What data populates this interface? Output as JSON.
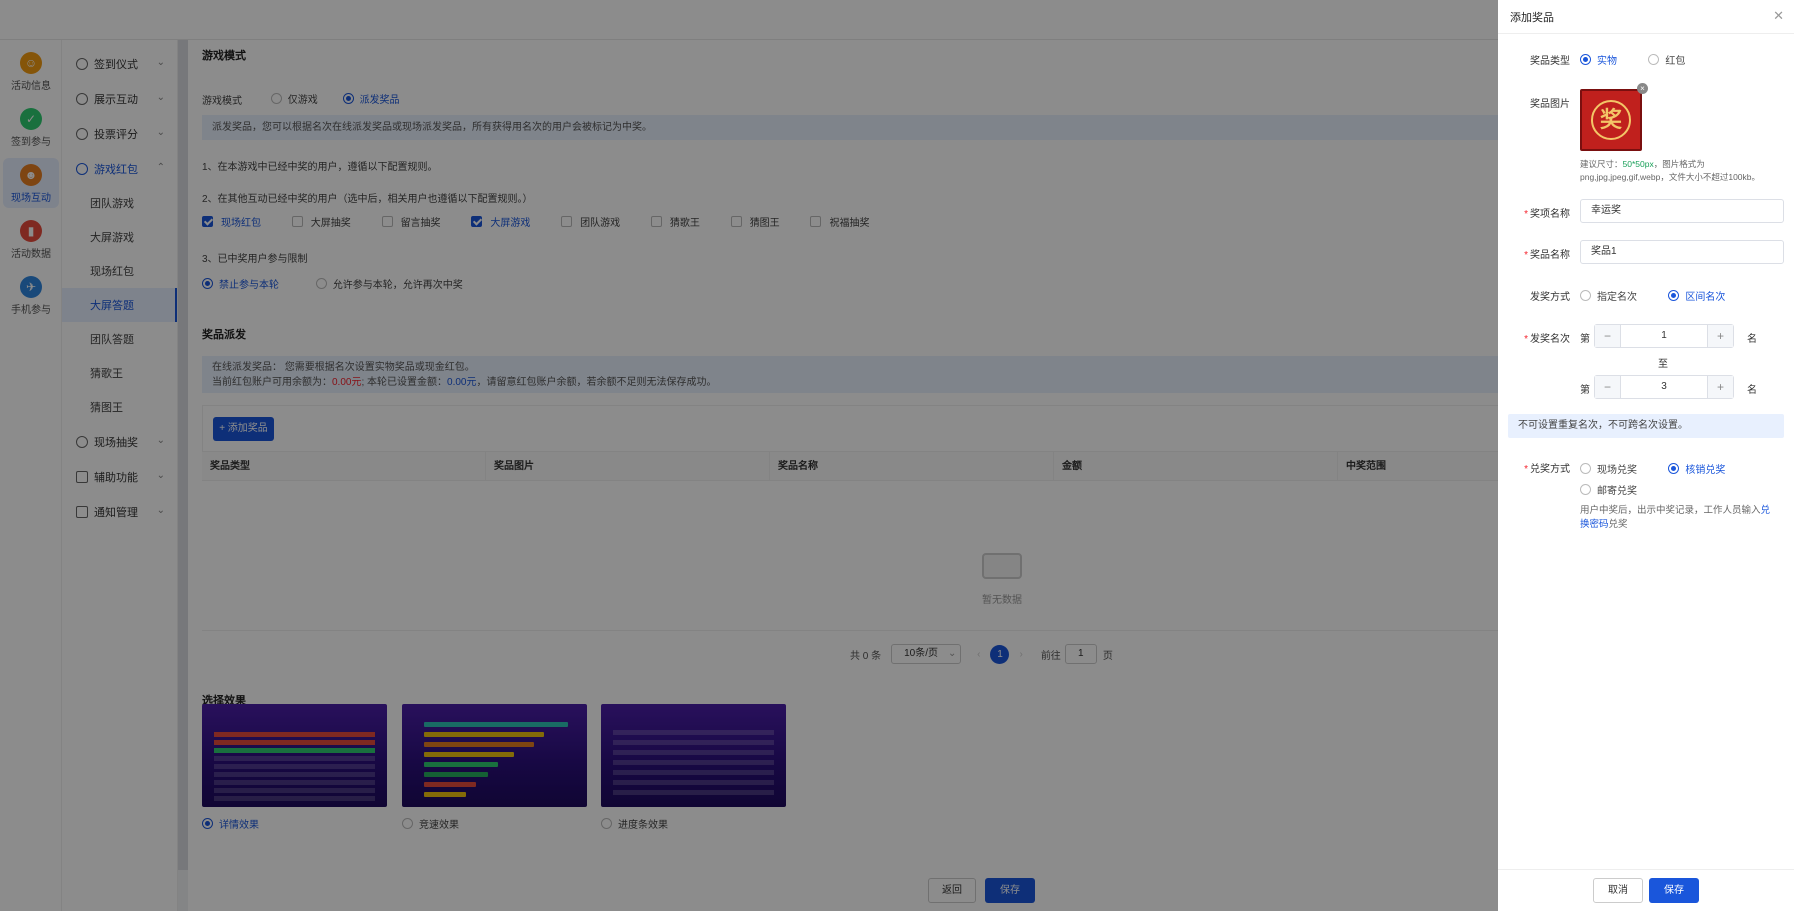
{
  "rail": [
    {
      "label": "活动信息",
      "icon": "activity-info-icon",
      "color": "#f39c12",
      "glyph": "☺"
    },
    {
      "label": "签到参与",
      "icon": "checkin-icon",
      "color": "#2ecc71",
      "glyph": "✓"
    },
    {
      "label": "现场互动",
      "icon": "interaction-icon",
      "color": "#e67e22",
      "glyph": "☻"
    },
    {
      "label": "活动数据",
      "icon": "data-icon",
      "color": "#e74c3c",
      "glyph": "▮"
    },
    {
      "label": "手机参与",
      "icon": "mobile-icon",
      "color": "#2e86de",
      "glyph": "✈"
    }
  ],
  "menu": {
    "groups": [
      {
        "label": "签到仪式"
      },
      {
        "label": "展示互动"
      },
      {
        "label": "投票评分"
      },
      {
        "label": "游戏红包"
      }
    ],
    "subs": [
      "团队游戏",
      "大屏游戏",
      "现场红包",
      "大屏答题",
      "团队答题",
      "猜歌王",
      "猜图王"
    ],
    "groups_after": [
      {
        "label": "现场抽奖"
      },
      {
        "label": "辅助功能"
      },
      {
        "label": "通知管理"
      }
    ]
  },
  "game_mode": {
    "section_title": "游戏模式",
    "label": "游戏模式",
    "options": [
      "仅游戏",
      "派发奖品"
    ],
    "info": "派发奖品，您可以根据名次在线派发奖品或现场派发奖品，所有获得用名次的用户会被标记为中奖。",
    "rule1": "1、在本游戏中已经中奖的用户，遵循以下配置规则。",
    "rule2": "2、在其他互动已经中奖的用户（选中后，相关用户也遵循以下配置规则。）",
    "checks": [
      "现场红包",
      "大屏抽奖",
      "留言抽奖",
      "大屏游戏",
      "团队游戏",
      "猜歌王",
      "猜图王",
      "祝福抽奖"
    ],
    "rule3": "3、已中奖用户参与限制",
    "limits": [
      "禁止参与本轮",
      "允许参与本轮，允许再次中奖"
    ]
  },
  "prize": {
    "section_title": "奖品派发",
    "info_line1": "在线派发奖品：  您需要根据名次设置实物奖品或现金红包。",
    "info_prefix": "当前红包账户可用余额为：",
    "balance": "0.00元",
    "info_mid": "; 本轮已设置金额：",
    "set_amount": "0.00元",
    "info_suffix": "，请留意红包账户余额，若余额不足则无法保存成功。",
    "add_button": "+ 添加奖品",
    "columns": [
      "奖品类型",
      "奖品图片",
      "奖品名称",
      "金额",
      "中奖范围"
    ],
    "empty_text": "暂无数据",
    "pagination": {
      "total": "共 0 条",
      "page_size": "10条/页",
      "current": "1",
      "goto_prefix": "前往",
      "goto_value": "1",
      "goto_suffix": "页"
    }
  },
  "effects": {
    "section_title": "选择效果",
    "options": [
      "详情效果",
      "竞速效果",
      "进度条效果"
    ]
  },
  "main_footer": {
    "back": "返回",
    "save": "保存"
  },
  "drawer": {
    "title": "添加奖品",
    "type_label": "奖品类型",
    "type_options": [
      "实物",
      "红包"
    ],
    "image_label": "奖品图片",
    "image_glyph": "奖",
    "hint_prefix": "建议尺寸：",
    "hint_size": "50*50px",
    "hint_suffix": "，图片格式为",
    "hint_line2": "png,jpg,jpeg,gif,webp，文件大小不超过100kb。",
    "award_label": "奖项名称",
    "award_value": "幸运奖",
    "prize_name_label": "奖品名称",
    "prize_name_value": "奖品1",
    "method_label": "发奖方式",
    "method_options": [
      "指定名次",
      "区间名次"
    ],
    "rank_label": "发奖名次",
    "rank_prefix": "第",
    "rank_from": "1",
    "rank_unit": "名",
    "rank_to_word": "至",
    "rank_to": "3",
    "notice": "不可设置重复名次，不可跨名次设置。",
    "redeem_label": "兑奖方式",
    "redeem_options": [
      "现场兑奖",
      "核销兑奖",
      "邮寄兑奖"
    ],
    "redeem_desc_prefix": "用户中奖后，出示中奖记录，工作人员输入",
    "redeem_link_a": "兑",
    "redeem_link_b": "换密码",
    "redeem_desc_suffix": "兑奖",
    "cancel": "取消",
    "save": "保存"
  },
  "colors": {
    "primary": "#1a56db",
    "danger": "#f5222d",
    "success": "#18a058"
  }
}
